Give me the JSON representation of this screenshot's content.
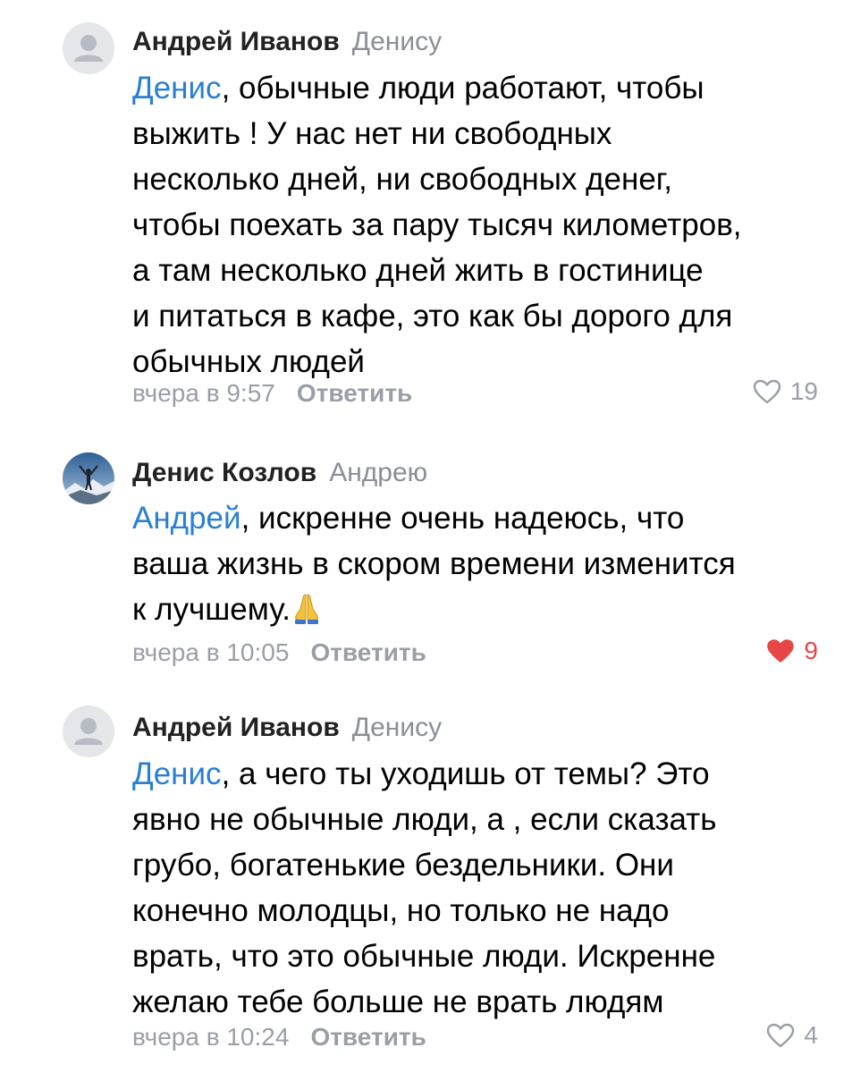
{
  "comments": [
    {
      "author": "Андрей Иванов",
      "reply_to": "Денису",
      "mention": "Денис",
      "text_lines": [
        ", обычные люди работают, чтобы",
        "выжить ! У нас нет ни свободных",
        "несколько дней, ни свободных денег,",
        "чтобы поехать за пару тысяч километров,",
        "а там несколько дней жить в гостинице",
        "и питаться в кафе, это как бы дорого для",
        "обычных людей"
      ],
      "time": "вчера в 9:57",
      "reply_label": "Ответить",
      "likes": "19",
      "liked": false,
      "avatar": "default-avatar"
    },
    {
      "author": "Денис Козлов",
      "reply_to": "Андрею",
      "mention": "Андрей",
      "text_lines": [
        ", искренне очень надеюсь, что",
        "ваша жизнь в скором времени изменится",
        "к лучшему."
      ],
      "emoji": "folded-hands",
      "time": "вчера в 10:05",
      "reply_label": "Ответить",
      "likes": "9",
      "liked": true,
      "avatar": "mountain-photo"
    },
    {
      "author": "Андрей Иванов",
      "reply_to": "Денису",
      "mention": "Денис",
      "text_lines": [
        ", а чего ты уходишь от темы? Это",
        "явно не обычные люди, а , если сказать",
        "грубо, богатенькие бездельники. Они",
        "конечно молодцы, но только не надо",
        "врать, что это обычные люди. Искренне",
        "желаю тебе больше не врать людям"
      ],
      "time": "вчера в 10:24",
      "reply_label": "Ответить",
      "likes": "4",
      "liked": false,
      "avatar": "default-avatar"
    }
  ],
  "colors": {
    "mention": "#2a7fd4",
    "meta": "#9a9ea6",
    "liked_heart": "#e64646",
    "avatar_bg": "#e4e6ea"
  }
}
